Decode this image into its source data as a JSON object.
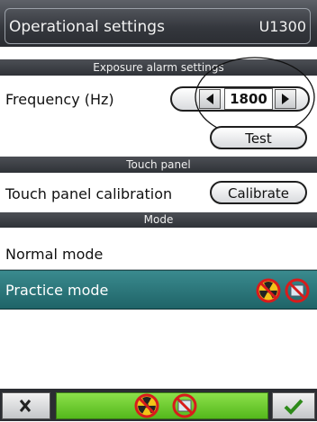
{
  "window": {
    "title": "Operational settings",
    "code": "U1300"
  },
  "sections": {
    "exposure_alarm": "Exposure alarm settings",
    "touch_panel": "Touch panel",
    "mode": "Mode"
  },
  "frequency": {
    "label": "Frequency (Hz)",
    "value": "1800"
  },
  "test_button": "Test",
  "calibration": {
    "label": "Touch panel calibration",
    "button": "Calibrate"
  },
  "modes": [
    {
      "label": "Normal mode",
      "selected": false
    },
    {
      "label": "Practice mode",
      "selected": true
    }
  ],
  "icons": {
    "practice_radiation": "no-radiation-icon",
    "practice_sensor": "no-sensor-icon",
    "footer_radiation": "no-radiation-icon",
    "footer_sensor": "no-sensor-icon",
    "cancel": "close-icon",
    "ok": "check-icon"
  },
  "colors": {
    "selected_row": "#2a7478",
    "footer_run": "#6ccd2e",
    "prohibition": "#d81c1c"
  }
}
